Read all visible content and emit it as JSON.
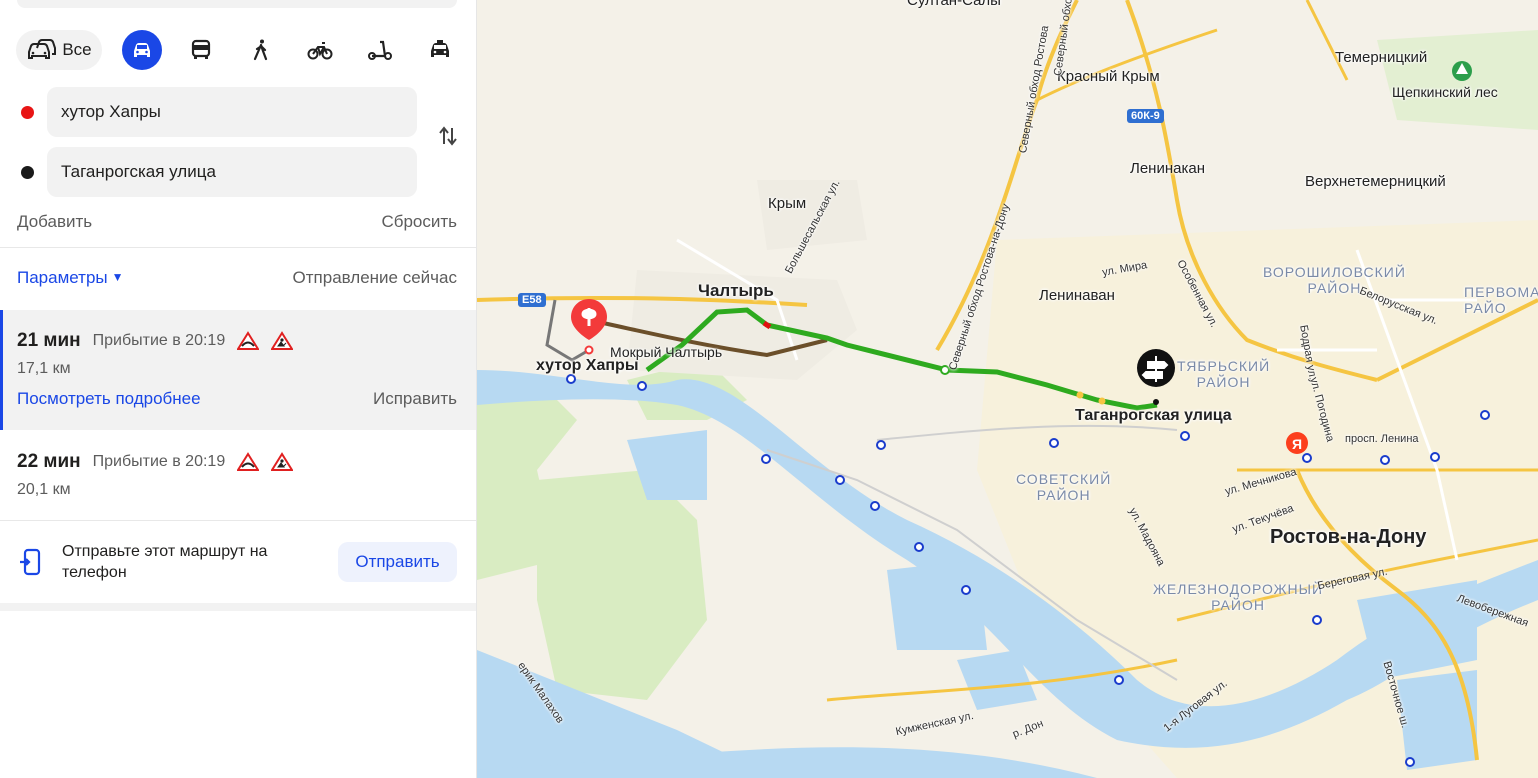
{
  "modes": {
    "all_label": "Все",
    "items": [
      {
        "name": "car-icon",
        "active": true
      },
      {
        "name": "bus-icon"
      },
      {
        "name": "pedestrian-icon"
      },
      {
        "name": "bicycle-icon"
      },
      {
        "name": "scooter-icon"
      },
      {
        "name": "taxi-icon"
      }
    ]
  },
  "waypoints": {
    "from": {
      "value": "хутор Хапры",
      "color": "#e81515"
    },
    "to": {
      "value": "Таганрогская улица",
      "color": "#1a1a1a"
    }
  },
  "actions": {
    "add": "Добавить",
    "reset": "Сбросить"
  },
  "params": {
    "label": "Параметры",
    "departure": "Отправление сейчас"
  },
  "routes": [
    {
      "time": "21 мин",
      "arrival": "Прибытие в 20:19",
      "distance": "17,1 км",
      "details": "Посмотреть подробнее",
      "fix": "Исправить"
    },
    {
      "time": "22 мин",
      "arrival": "Прибытие в 20:19",
      "distance": "20,1 км"
    }
  ],
  "send": {
    "text": "Отправьте этот маршрут на телефон",
    "button": "Отправить"
  },
  "map": {
    "labels": {
      "sultan": "Султан-Салы",
      "krasny_krym": "Красный Крым",
      "temernitsky": "Темерницкий",
      "shchepkinsky": "Щепкинский лес",
      "leninakan": "Ленинакан",
      "verkhnetemernitsky": "Верхнетемерницкий",
      "krym": "Крым",
      "bolshesalskaya": "Большесальская ул.",
      "chaltyr": "Чалтырь",
      "mira": "ул. Мира",
      "leninavan": "Ленинаван",
      "osobennaya": "Особенная ул.",
      "voroshilovsky": "ВОРОШИЛОВСКИЙ\nРАЙОН",
      "pervomaysky": "ПЕРВОМА\nРАЙО",
      "belorusskaya": "Белорусская ул.",
      "bodraya": "Бодрая ул.",
      "pogodina": "ул. Погодина",
      "oktyabrsky": "ТЯБРЬСКИЙ\nРАЙОН",
      "khutor_khapry": "хутор Хапры",
      "mokry_chaltyr": "Мокрый Чалтырь",
      "taganrogskaya": "Таганрогская улица",
      "sovetsky": "СОВЕТСКИЙ\nРАЙОН",
      "mechnikova": "ул. Мечникова",
      "tekuchyova": "ул. Текучёва",
      "madoyana": "ул. Мадояна",
      "lenina": "просп. Ленина",
      "rostov": "Ростов-на-Дону",
      "zheleznodorozhny": "ЖЕЛЕЗНОДОРОЖНЫЙ\nРАЙОН",
      "beregovaya": "Береговая ул.",
      "levoberezhnaya": "Левобережная",
      "vostochnoe": "Восточное ш.",
      "lugovaya": "1-я Луговая ул.",
      "kumzhenskaya": "Кумженская ул.",
      "don": "р. Дон",
      "malakhov": "ерик Малахов",
      "severny1": "Северный обход Ростова-на-Дону",
      "severny2": "Северный обход Ростова-на-Дону",
      "severny3": "Северный обход Ростова",
      "e58": "E58",
      "r60k9": "60К-9"
    }
  }
}
